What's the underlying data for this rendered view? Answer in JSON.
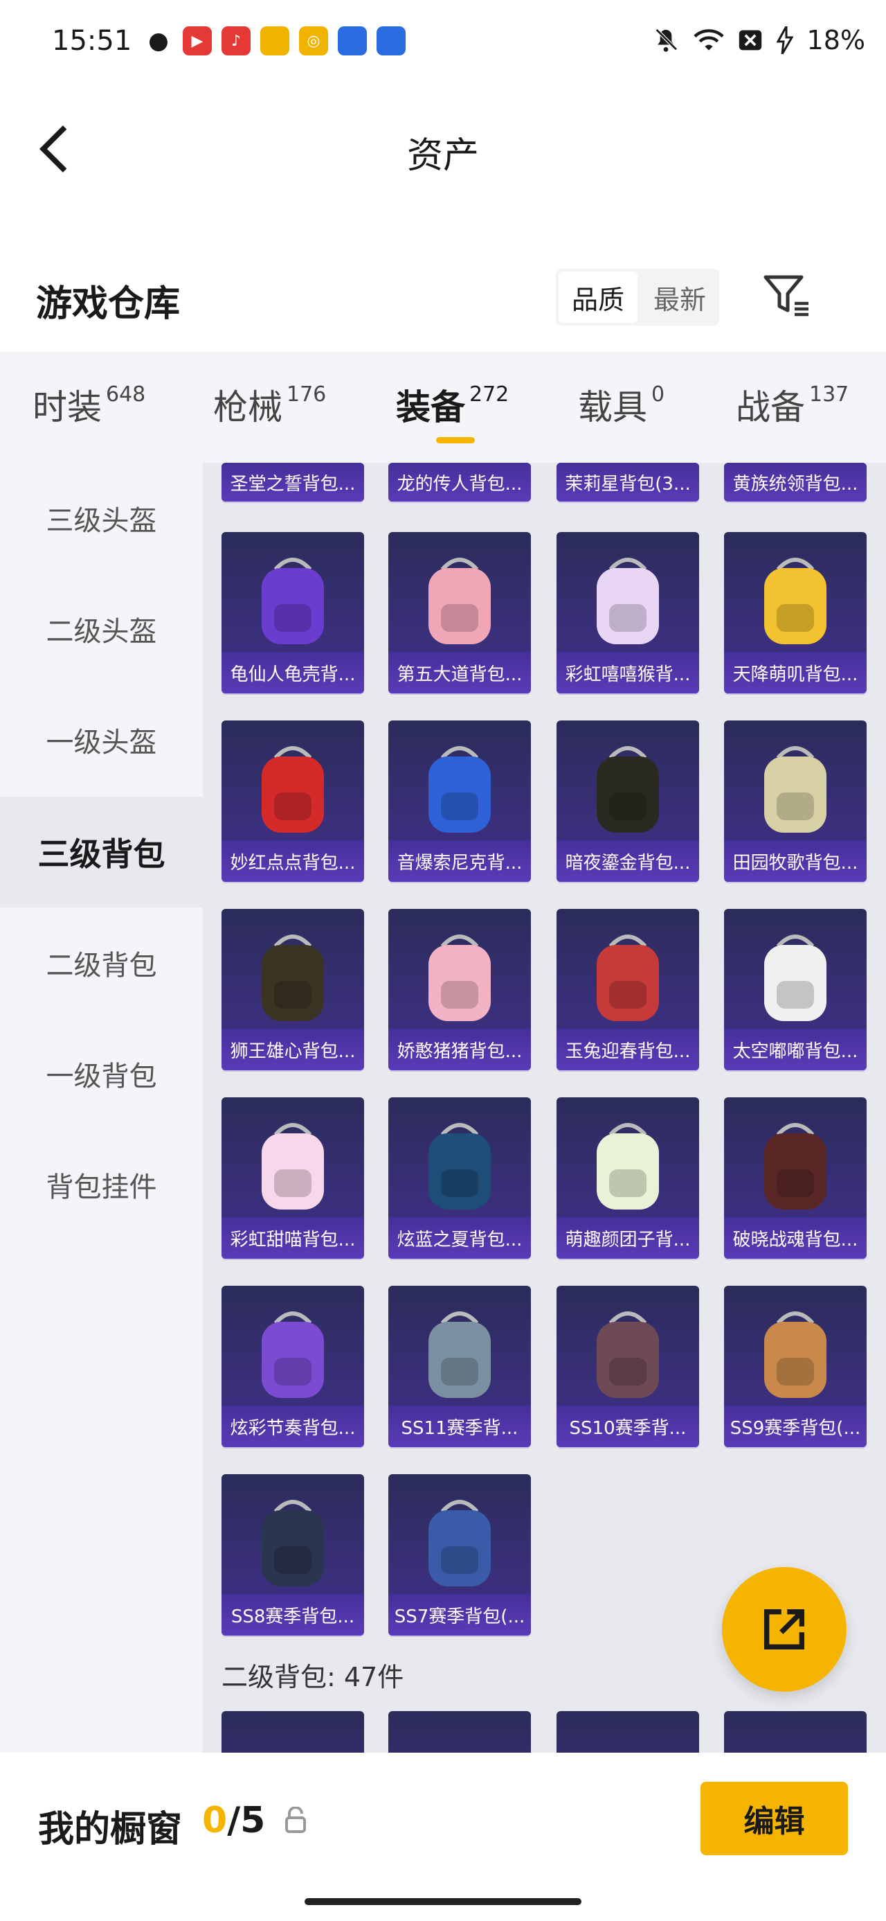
{
  "status_bar": {
    "time": "15:51",
    "battery": "18%",
    "apps": [
      "wechat",
      "video",
      "music",
      "game1",
      "game2",
      "game3",
      "game4"
    ],
    "app_colors": [
      "#1a1a1a",
      "#e53935",
      "#e53935",
      "#f0b400",
      "#f0b400",
      "#2a6de0",
      "#2a6de0"
    ]
  },
  "header": {
    "title": "资产",
    "back_icon": "back-arrow-icon"
  },
  "section": {
    "title": "游戏仓库",
    "sort_options": [
      "品质",
      "最新"
    ],
    "active_sort": "品质"
  },
  "tabs": [
    {
      "label": "时装",
      "count": "648"
    },
    {
      "label": "枪械",
      "count": "176"
    },
    {
      "label": "装备",
      "count": "272"
    },
    {
      "label": "载具",
      "count": "0"
    },
    {
      "label": "战备",
      "count": "137"
    }
  ],
  "active_tab": "装备",
  "sidebar": [
    {
      "label": "三级头盔"
    },
    {
      "label": "二级头盔"
    },
    {
      "label": "一级头盔"
    },
    {
      "label": "三级背包"
    },
    {
      "label": "二级背包"
    },
    {
      "label": "一级背包"
    },
    {
      "label": "背包挂件"
    }
  ],
  "active_sidebar": "三级背包",
  "top_row_items": [
    "圣堂之誓背包...",
    "龙的传人背包...",
    "茉莉星背包(3...",
    "黄族统领背包..."
  ],
  "items": [
    {
      "name": "龟仙人龟壳背...",
      "color": "#6a3ccf"
    },
    {
      "name": "第五大道背包...",
      "color": "#f1a6b8"
    },
    {
      "name": "彩虹嘻嘻猴背...",
      "color": "#e9d6f5"
    },
    {
      "name": "天降萌叽背包...",
      "color": "#f2c230"
    },
    {
      "name": "妙红点点背包...",
      "color": "#d42a2a"
    },
    {
      "name": "音爆索尼克背...",
      "color": "#2f62d6"
    },
    {
      "name": "暗夜鎏金背包...",
      "color": "#2b2a22"
    },
    {
      "name": "田园牧歌背包...",
      "color": "#d8d1a6"
    },
    {
      "name": "狮王雄心背包...",
      "color": "#3b3424"
    },
    {
      "name": "娇憨猪猪背包...",
      "color": "#f3b2c4"
    },
    {
      "name": "玉兔迎春背包...",
      "color": "#c63a3a"
    },
    {
      "name": "太空嘟嘟背包...",
      "color": "#f0f0f0"
    },
    {
      "name": "彩虹甜喵背包...",
      "color": "#f7d7ea"
    },
    {
      "name": "炫蓝之夏背包...",
      "color": "#1e4d78"
    },
    {
      "name": "萌趣颜团子背...",
      "color": "#e9f2d7"
    },
    {
      "name": "破晓战魂背包...",
      "color": "#5b2626"
    },
    {
      "name": "炫彩节奏背包...",
      "color": "#7b4bd1"
    },
    {
      "name": "SS11赛季背...",
      "color": "#7a8fa0"
    },
    {
      "name": "SS10赛季背...",
      "color": "#6e4a57"
    },
    {
      "name": "SS9赛季背包(...",
      "color": "#c9894a"
    },
    {
      "name": "SS8赛季背包...",
      "color": "#2a3550"
    },
    {
      "name": "SS7赛季背包(...",
      "color": "#3a5ba8"
    }
  ],
  "next_section_label": "二级背包: 47件",
  "bottom": {
    "window_label": "我的橱窗",
    "window_current": "0",
    "window_total": "/5",
    "edit_label": "编辑"
  },
  "colors": {
    "accent": "#f5b400",
    "card_bg": "#3a2f7a",
    "card_name_bg": "#5a3bb8"
  }
}
